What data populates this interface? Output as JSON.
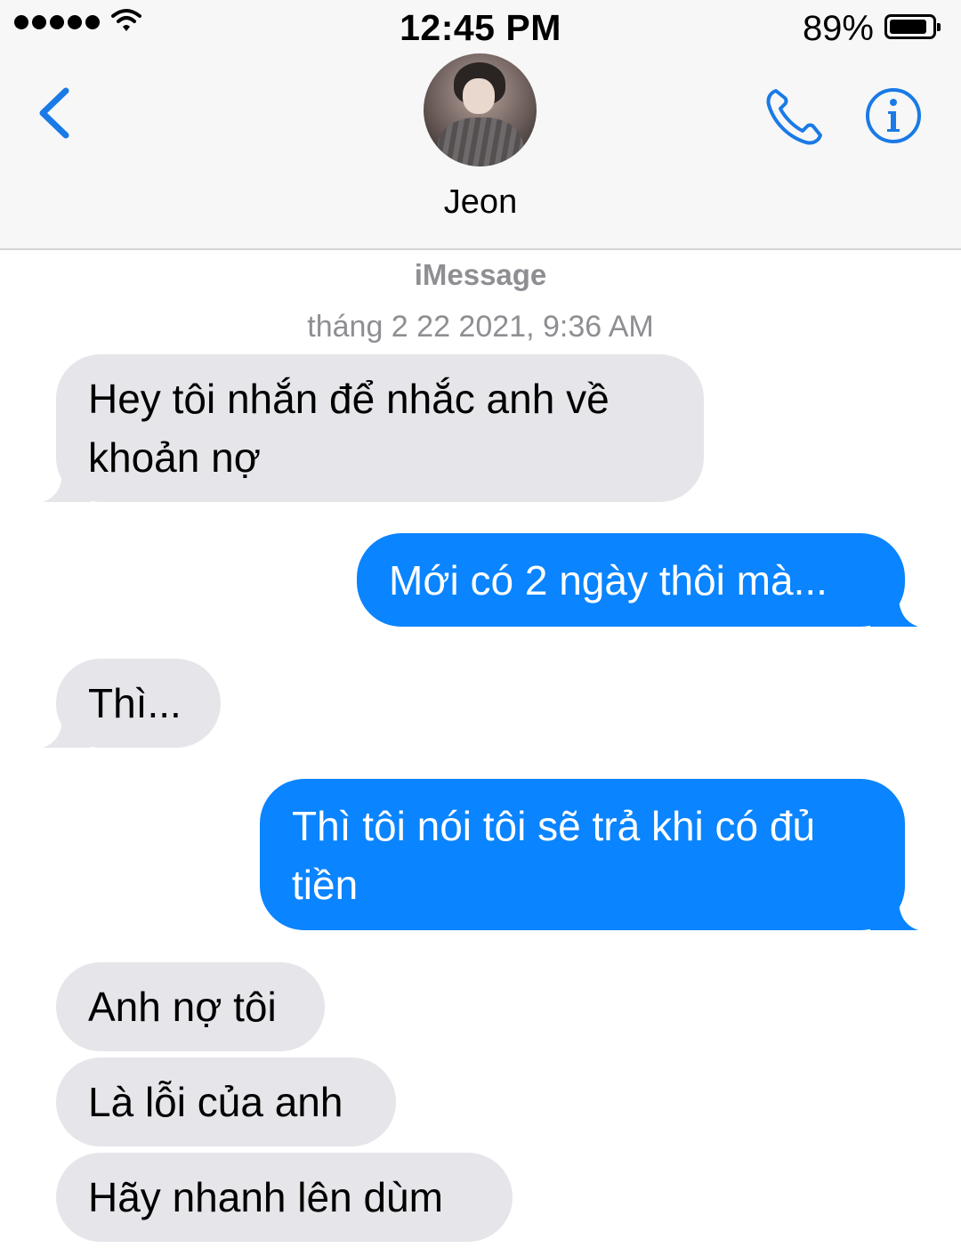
{
  "status_bar": {
    "signal_dots": 5,
    "time": "12:45 PM",
    "battery_percent": "89%",
    "battery_level": 0.89
  },
  "header": {
    "contact_name": "Jeon",
    "back_icon": "chevron-left-icon",
    "call_icon": "phone-icon",
    "info_icon": "info-icon",
    "accent_color": "#1a7ae6"
  },
  "conversation": {
    "service": "iMessage",
    "timestamp": "tháng 2 22 2021, 9:36 AM",
    "messages": [
      {
        "direction": "received",
        "text": "Hey tôi nhắn để nhắc anh về khoản nợ"
      },
      {
        "direction": "sent",
        "text": "Mới có 2 ngày thôi mà..."
      },
      {
        "direction": "received",
        "text": "Thì..."
      },
      {
        "direction": "sent",
        "text": "Thì tôi nói tôi sẽ trả khi có đủ tiền"
      },
      {
        "direction": "received",
        "text": "Anh nợ tôi"
      },
      {
        "direction": "received",
        "text": "Là lỗi của anh"
      },
      {
        "direction": "received",
        "text": "Hãy nhanh lên dùm"
      }
    ]
  },
  "colors": {
    "received_bubble": "#e5e5ea",
    "sent_bubble": "#0a84ff",
    "meta_text": "#8e8e93"
  }
}
